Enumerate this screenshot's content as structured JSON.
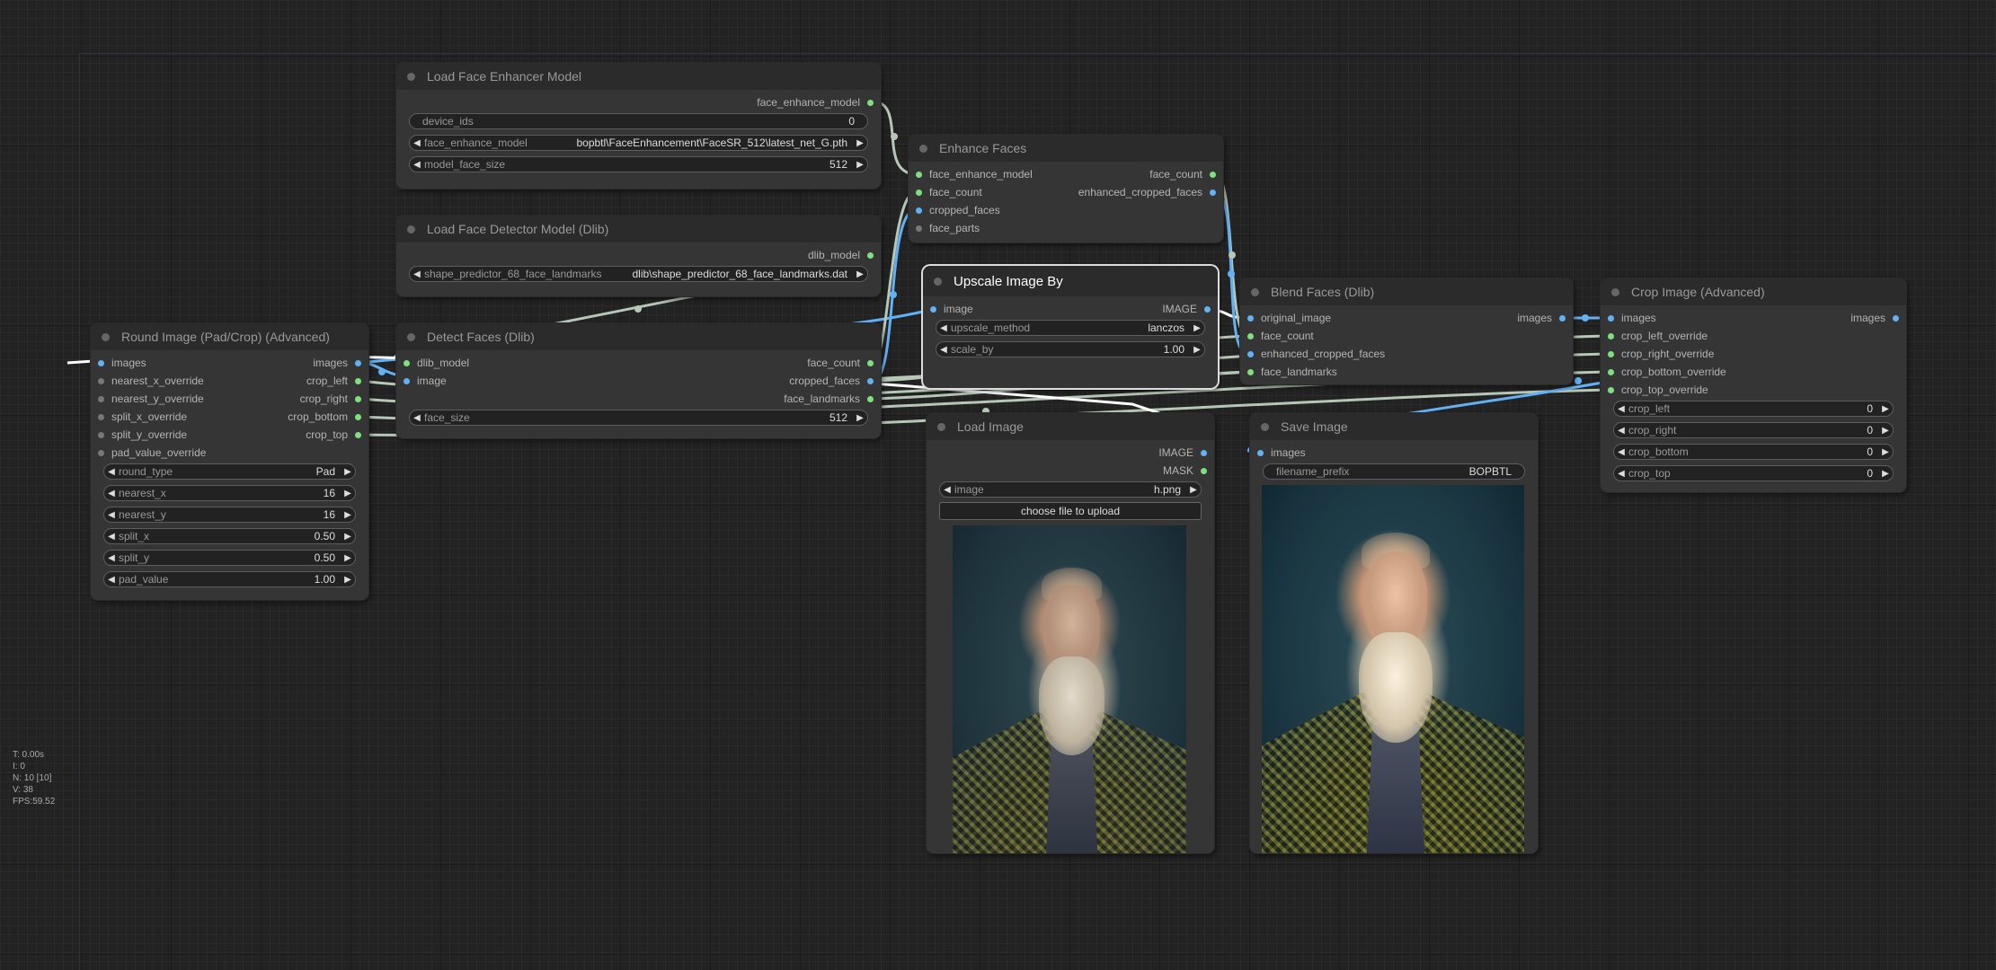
{
  "app": "ComfyUI node graph",
  "nodes": {
    "load_face_enhancer": {
      "title": "Load Face Enhancer Model",
      "outputs": [
        "face_enhance_model"
      ],
      "widgets": [
        {
          "label": "device_ids",
          "value": "0"
        },
        {
          "label": "face_enhance_model",
          "value": "bopbtl\\FaceEnhancement\\FaceSR_512\\latest_net_G.pth"
        },
        {
          "label": "model_face_size",
          "value": "512"
        }
      ]
    },
    "load_face_detector": {
      "title": "Load Face Detector Model (Dlib)",
      "outputs": [
        "dlib_model"
      ],
      "widgets": [
        {
          "label": "shape_predictor_68_face_landmarks",
          "value": "dlib\\shape_predictor_68_face_landmarks.dat"
        }
      ]
    },
    "enhance_faces": {
      "title": "Enhance Faces",
      "inputs": [
        "face_enhance_model",
        "face_count",
        "cropped_faces",
        "face_parts"
      ],
      "outputs": [
        "face_count",
        "enhanced_cropped_faces"
      ]
    },
    "upscale_image": {
      "title": "Upscale Image By",
      "inputs": [
        "image"
      ],
      "outputs": [
        "IMAGE"
      ],
      "widgets": [
        {
          "label": "upscale_method",
          "value": "lanczos"
        },
        {
          "label": "scale_by",
          "value": "1.00"
        }
      ]
    },
    "blend_faces": {
      "title": "Blend Faces (Dlib)",
      "inputs": [
        "original_image",
        "face_count",
        "enhanced_cropped_faces",
        "face_landmarks"
      ],
      "outputs": [
        "images"
      ]
    },
    "crop_image": {
      "title": "Crop Image (Advanced)",
      "inputs": [
        "images",
        "crop_left_override",
        "crop_right_override",
        "crop_bottom_override",
        "crop_top_override"
      ],
      "outputs": [
        "images"
      ],
      "widgets": [
        {
          "label": "crop_left",
          "value": "0"
        },
        {
          "label": "crop_right",
          "value": "0"
        },
        {
          "label": "crop_bottom",
          "value": "0"
        },
        {
          "label": "crop_top",
          "value": "0"
        }
      ]
    },
    "round_image": {
      "title": "Round Image (Pad/Crop) (Advanced)",
      "inputs": [
        "images",
        "nearest_x_override",
        "nearest_y_override",
        "split_x_override",
        "split_y_override",
        "pad_value_override"
      ],
      "outputs": [
        "images",
        "crop_left",
        "crop_right",
        "crop_bottom",
        "crop_top"
      ],
      "widgets": [
        {
          "label": "round_type",
          "value": "Pad"
        },
        {
          "label": "nearest_x",
          "value": "16"
        },
        {
          "label": "nearest_y",
          "value": "16"
        },
        {
          "label": "split_x",
          "value": "0.50"
        },
        {
          "label": "split_y",
          "value": "0.50"
        },
        {
          "label": "pad_value",
          "value": "1.00"
        }
      ]
    },
    "detect_faces": {
      "title": "Detect Faces (Dlib)",
      "inputs": [
        "dlib_model",
        "image"
      ],
      "outputs": [
        "face_count",
        "cropped_faces",
        "face_landmarks"
      ],
      "widgets": [
        {
          "label": "face_size",
          "value": "512"
        }
      ]
    },
    "load_image": {
      "title": "Load Image",
      "outputs": [
        "IMAGE",
        "MASK"
      ],
      "widgets": [
        {
          "label": "image",
          "value": "h.png"
        }
      ],
      "upload_button": "choose file to upload"
    },
    "save_image": {
      "title": "Save Image",
      "inputs": [
        "images"
      ],
      "widgets": [
        {
          "label": "filename_prefix",
          "value": "BOPBTL"
        }
      ]
    }
  },
  "stats": {
    "t": "T: 0.00s",
    "i": "I: 0",
    "n": "N: 10 [10]",
    "v": "V: 38",
    "fps": "FPS:59.52"
  },
  "arrows": {
    "left": "◀",
    "right": "▶"
  }
}
